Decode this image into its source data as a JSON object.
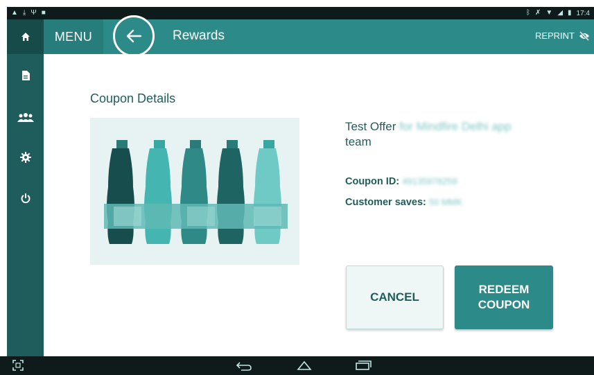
{
  "status_bar": {
    "time": "17:4"
  },
  "header": {
    "menu_label": "MENU",
    "title": "Rewards",
    "reprint_label": "REPRINT"
  },
  "sidebar": {
    "items": [
      {
        "icon": "home-icon"
      },
      {
        "icon": "document-icon"
      },
      {
        "icon": "users-icon"
      },
      {
        "icon": "gear-icon"
      },
      {
        "icon": "power-icon"
      }
    ]
  },
  "coupon": {
    "section_title": "Coupon Details",
    "offer_title": "Test Offer",
    "offer_title_hidden": "for Mindfire Delhi app",
    "offer_title_tail": "team",
    "coupon_id_label": "Coupon ID:",
    "coupon_id_value": "49135978259",
    "customer_saves_label": "Customer saves:",
    "customer_saves_value": "50 MMK"
  },
  "actions": {
    "cancel_label": "CANCEL",
    "redeem_label": "REDEEM\nCOUPON"
  },
  "colors": {
    "primary": "#2c8a88",
    "sidebar": "#1f5d5c",
    "text": "#1f5d5c"
  }
}
